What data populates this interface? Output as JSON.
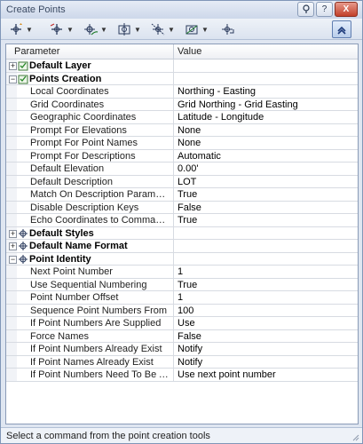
{
  "window": {
    "title": "Create Points"
  },
  "title_buttons": {
    "help": "?",
    "close": "X"
  },
  "toolbar": {
    "tools": [
      "points-miscellaneous-icon",
      "points-intersection-icon",
      "points-alignment-icon",
      "points-surface-icon",
      "points-interpolate-icon",
      "points-slope-icon",
      "import-points-icon"
    ],
    "expand_icon": "expand-collapse-icon"
  },
  "grid": {
    "col_parameter": "Parameter",
    "col_value": "Value",
    "groups": [
      {
        "label": "Default Layer",
        "expanded": false,
        "icon": "layer-check-icon",
        "rows": []
      },
      {
        "label": "Points Creation",
        "expanded": true,
        "icon": "layer-check-icon",
        "rows": [
          {
            "label": "Local Coordinates",
            "value": "Northing - Easting"
          },
          {
            "label": "Grid Coordinates",
            "value": "Grid Northing - Grid Easting"
          },
          {
            "label": "Geographic Coordinates",
            "value": "Latitude - Longitude"
          },
          {
            "label": "Prompt For Elevations",
            "value": "None"
          },
          {
            "label": "Prompt For Point Names",
            "value": "None"
          },
          {
            "label": "Prompt For Descriptions",
            "value": "Automatic"
          },
          {
            "label": "Default Elevation",
            "value": "0.00'"
          },
          {
            "label": "Default Description",
            "value": "LOT"
          },
          {
            "label": "Match On Description Parameters ...",
            "value": "True"
          },
          {
            "label": "Disable Description Keys",
            "value": "False"
          },
          {
            "label": "Echo Coordinates to Command Line",
            "value": "True"
          }
        ]
      },
      {
        "label": "Default Styles",
        "expanded": false,
        "icon": "point-style-icon",
        "rows": []
      },
      {
        "label": "Default Name Format",
        "expanded": false,
        "icon": "point-style-icon",
        "rows": []
      },
      {
        "label": "Point Identity",
        "expanded": true,
        "icon": "point-style-icon",
        "rows": [
          {
            "label": "Next Point Number",
            "value": "1"
          },
          {
            "label": "Use Sequential Numbering",
            "value": "True"
          },
          {
            "label": "Point Number Offset",
            "value": "1"
          },
          {
            "label": "Sequence Point Numbers From",
            "value": "100"
          },
          {
            "label": "If Point Numbers Are Supplied",
            "value": "Use"
          },
          {
            "label": "Force Names",
            "value": "False"
          },
          {
            "label": "If Point Numbers Already Exist",
            "value": "Notify"
          },
          {
            "label": "If Point Names Already Exist",
            "value": "Notify"
          },
          {
            "label": "If Point Numbers Need To Be Assi...",
            "value": "Use next point number"
          }
        ]
      }
    ]
  },
  "status": {
    "text": "Select a command from the point creation tools"
  }
}
